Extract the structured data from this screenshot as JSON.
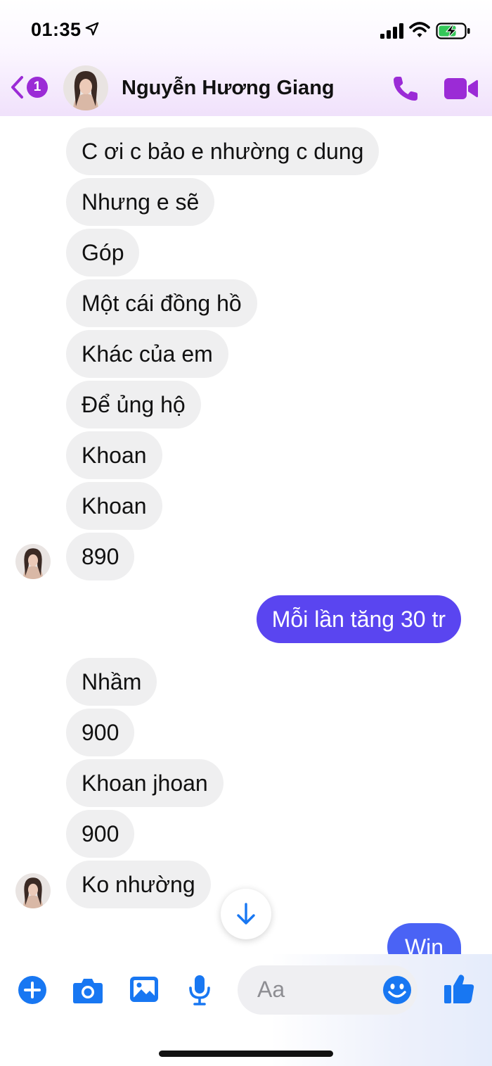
{
  "status_bar": {
    "time": "01:35"
  },
  "header": {
    "back_badge": "1",
    "contact_name": "Nguyễn Hương Giang"
  },
  "messages": [
    {
      "text": "C ơi c bảo e nhường c dung",
      "from": "them"
    },
    {
      "text": "Nhưng e sẽ",
      "from": "them"
    },
    {
      "text": "Góp",
      "from": "them"
    },
    {
      "text": "Một cái đồng hồ",
      "from": "them"
    },
    {
      "text": "Khác của em",
      "from": "them"
    },
    {
      "text": "Để ủng hộ",
      "from": "them"
    },
    {
      "text": "Khoan",
      "from": "them"
    },
    {
      "text": "Khoan",
      "from": "them"
    },
    {
      "text": "890",
      "from": "them"
    },
    {
      "text": "Mỗi lần tăng 30 tr",
      "from": "me"
    },
    {
      "text": "Nhầm",
      "from": "them"
    },
    {
      "text": "900",
      "from": "them"
    },
    {
      "text": "Khoan jhoan",
      "from": "them"
    },
    {
      "text": "900",
      "from": "them"
    },
    {
      "text": "Ko nhường",
      "from": "them"
    },
    {
      "text": "Win",
      "from": "me"
    }
  ],
  "composer": {
    "placeholder": "Aa",
    "icons": [
      "plus-icon",
      "camera-icon",
      "image-icon",
      "microphone-icon",
      "emoji-icon",
      "thumbs-up-icon"
    ]
  },
  "colors": {
    "accent": "#9b2bd6",
    "my_bubble": "#5a45f0",
    "their_bubble": "#efeff0",
    "composer_icon": "#1877f2"
  }
}
